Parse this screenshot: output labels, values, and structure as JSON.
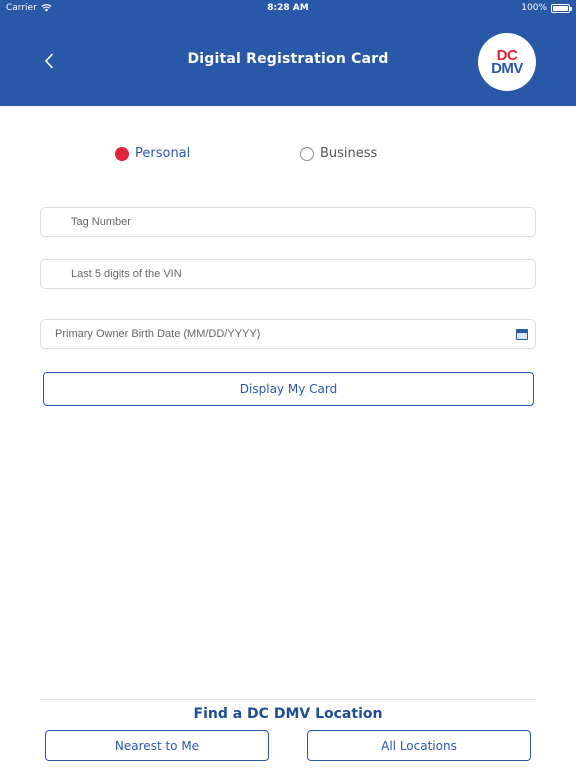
{
  "status_bar": {
    "carrier": "Carrier",
    "time": "8:28 AM",
    "battery": "100%"
  },
  "header": {
    "title": "Digital Registration Card",
    "logo_line1": "DC",
    "logo_line2": "DMV",
    "background_color": "#2a58a8"
  },
  "form": {
    "radio_personal": "Personal",
    "radio_business": "Business",
    "selected": "Personal",
    "tag_placeholder": "Tag Number",
    "vin_placeholder": "Last 5 digits of the VIN",
    "dob_placeholder": "Primary Owner Birth Date (MM/DD/YYYY)",
    "display_button": "Display My Card"
  },
  "locations": {
    "title": "Find a DC DMV Location",
    "nearest_button": "Nearest to Me",
    "all_button": "All Locations"
  },
  "colors": {
    "accent": "#2a58a8",
    "selected_radio": "#e0253a"
  }
}
